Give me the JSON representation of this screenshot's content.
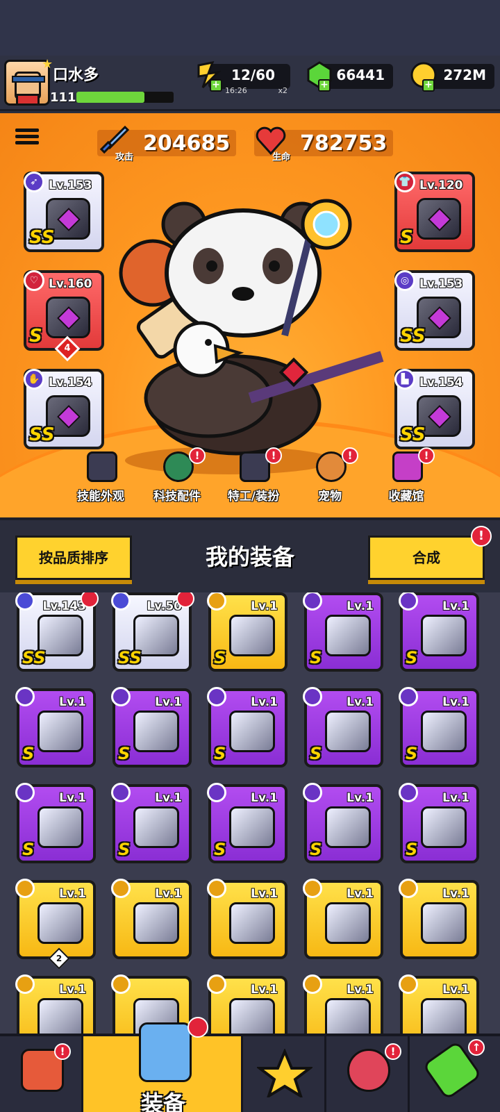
{
  "header": {
    "username": "口水多",
    "player_level": "111",
    "xp_fraction": 0.7,
    "energy": {
      "value": "12/60",
      "timer": "16:26",
      "multiplier": "x2"
    },
    "gems": "66441",
    "gold": "272M"
  },
  "hero": {
    "attack": {
      "label": "攻击",
      "value": "204685"
    },
    "health": {
      "label": "生命",
      "value": "782753"
    },
    "left_slots": [
      {
        "level": "Lv.153",
        "grade": "SS"
      },
      {
        "level": "Lv.160",
        "grade": "S",
        "stars": "4"
      },
      {
        "level": "Lv.154",
        "grade": "SS"
      }
    ],
    "right_slots": [
      {
        "level": "Lv.120",
        "grade": "S"
      },
      {
        "level": "Lv.153",
        "grade": "SS"
      },
      {
        "level": "Lv.154",
        "grade": "SS"
      }
    ],
    "quicknav": [
      "技能外观",
      "科技配件",
      "特工/装扮",
      "宠物",
      "收藏馆"
    ]
  },
  "equipment": {
    "title": "我的装备",
    "sort_label": "按品质排序",
    "compose_label": "合成",
    "items": [
      {
        "level": "Lv.143",
        "grade": "SS",
        "rarity": "white"
      },
      {
        "level": "Lv.50",
        "grade": "SS",
        "rarity": "white"
      },
      {
        "level": "Lv.1",
        "grade": "S",
        "rarity": "gold"
      },
      {
        "level": "Lv.1",
        "grade": "S",
        "rarity": "purple"
      },
      {
        "level": "Lv.1",
        "grade": "S",
        "rarity": "purple"
      },
      {
        "level": "Lv.1",
        "grade": "S",
        "rarity": "purple"
      },
      {
        "level": "Lv.1",
        "grade": "S",
        "rarity": "purple"
      },
      {
        "level": "Lv.1",
        "grade": "S",
        "rarity": "purple"
      },
      {
        "level": "Lv.1",
        "grade": "S",
        "rarity": "purple"
      },
      {
        "level": "Lv.1",
        "grade": "S",
        "rarity": "purple"
      },
      {
        "level": "Lv.1",
        "grade": "S",
        "rarity": "purple"
      },
      {
        "level": "Lv.1",
        "grade": "S",
        "rarity": "purple"
      },
      {
        "level": "Lv.1",
        "grade": "S",
        "rarity": "purple"
      },
      {
        "level": "Lv.1",
        "grade": "S",
        "rarity": "purple"
      },
      {
        "level": "Lv.1",
        "grade": "S",
        "rarity": "purple"
      },
      {
        "level": "Lv.1",
        "grade": "",
        "rarity": "gold",
        "count": "2"
      },
      {
        "level": "Lv.1",
        "grade": "",
        "rarity": "gold"
      },
      {
        "level": "Lv.1",
        "grade": "",
        "rarity": "gold"
      },
      {
        "level": "Lv.1",
        "grade": "",
        "rarity": "gold"
      },
      {
        "level": "Lv.1",
        "grade": "",
        "rarity": "gold"
      },
      {
        "level": "Lv.1",
        "grade": "",
        "rarity": "gold"
      },
      {
        "level": "",
        "grade": "",
        "rarity": "gold"
      },
      {
        "level": "Lv.1",
        "grade": "",
        "rarity": "gold"
      },
      {
        "level": "Lv.1",
        "grade": "",
        "rarity": "gold"
      },
      {
        "level": "Lv.1",
        "grade": "",
        "rarity": "gold"
      }
    ]
  },
  "nav": {
    "active_label": "装备"
  },
  "colors": {
    "accent": "#ffc327",
    "purple": "#9a3ee0",
    "alert": "#e2233a"
  }
}
